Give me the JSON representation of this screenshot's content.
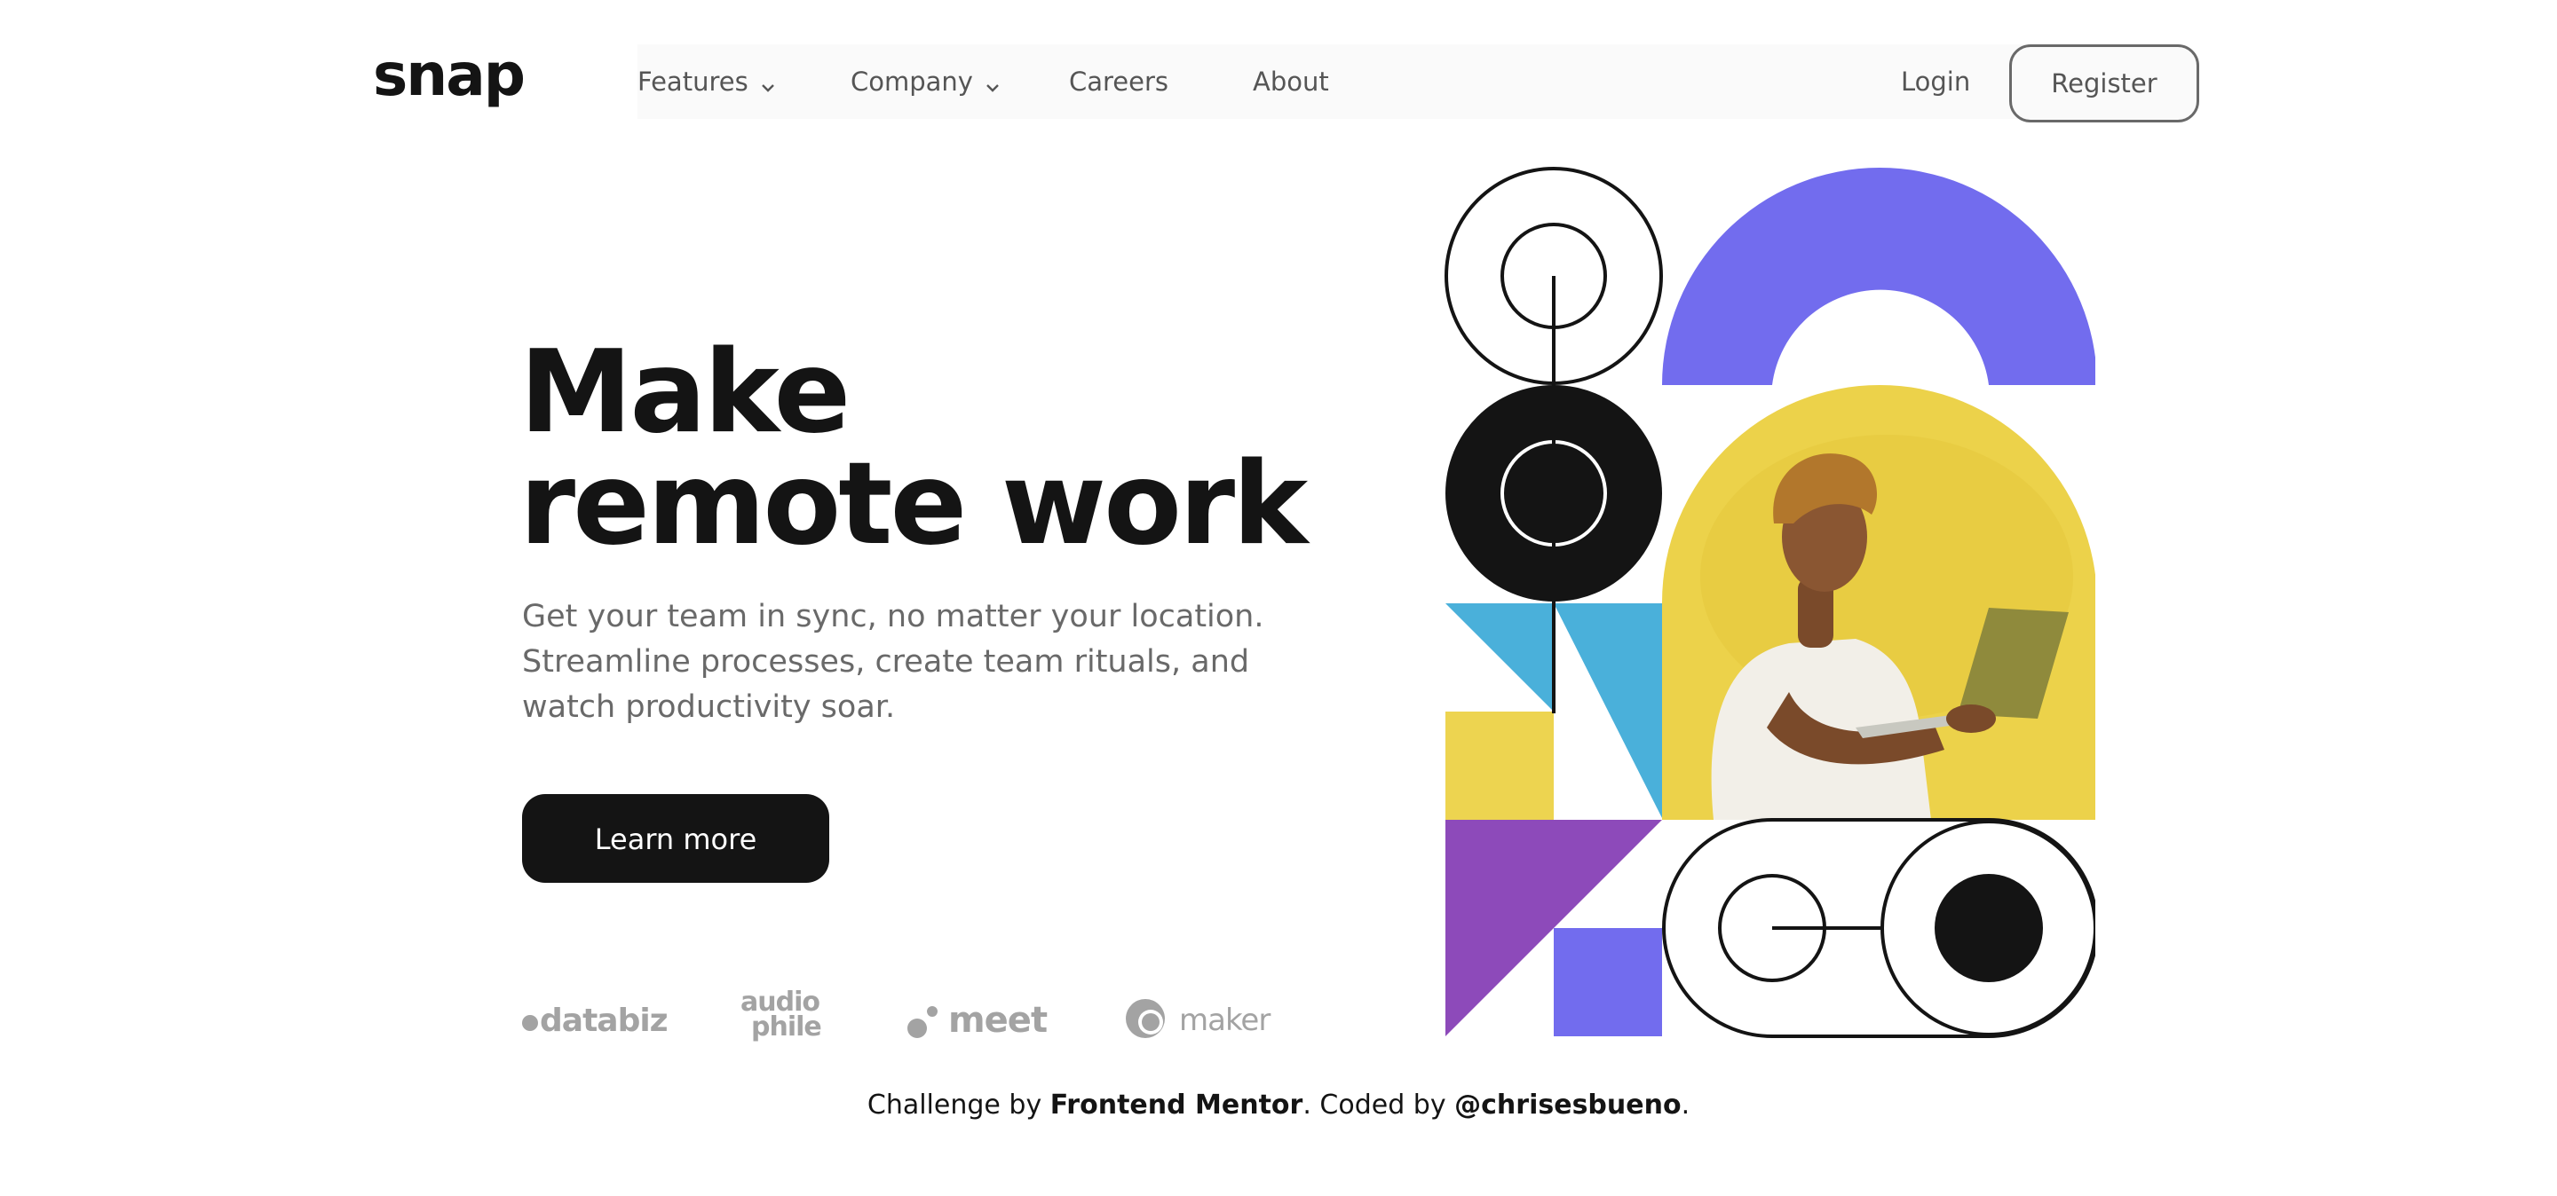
{
  "header": {
    "logo": "snap",
    "nav": {
      "features": "Features",
      "company": "Company",
      "careers": "Careers",
      "about": "About"
    },
    "login": "Login",
    "register": "Register"
  },
  "hero": {
    "title_line1": "Make",
    "title_line2": "remote work",
    "description_line1": "Get your team in sync, no matter your location.",
    "description_line2": "Streamline processes, create team rituals, and",
    "description_line3": "watch productivity soar.",
    "cta": "Learn more"
  },
  "clients": {
    "databiz": "databiz",
    "audiophile_top": "audio",
    "audiophile_bottom": "phile",
    "meet": "meet",
    "maker": "maker"
  },
  "footer": {
    "prefix": "Challenge by ",
    "mentor": "Frontend Mentor",
    "middle": ". Coded by ",
    "author": "@chrisesbueno",
    "suffix": "."
  },
  "colors": {
    "text_dark": "#141414",
    "text_gray": "#696969",
    "purple": "#726CEE",
    "violet": "#8D4ABA",
    "blue": "#4AB0DA",
    "yellow": "#EDD450",
    "client_gray": "#A3A3A3"
  }
}
